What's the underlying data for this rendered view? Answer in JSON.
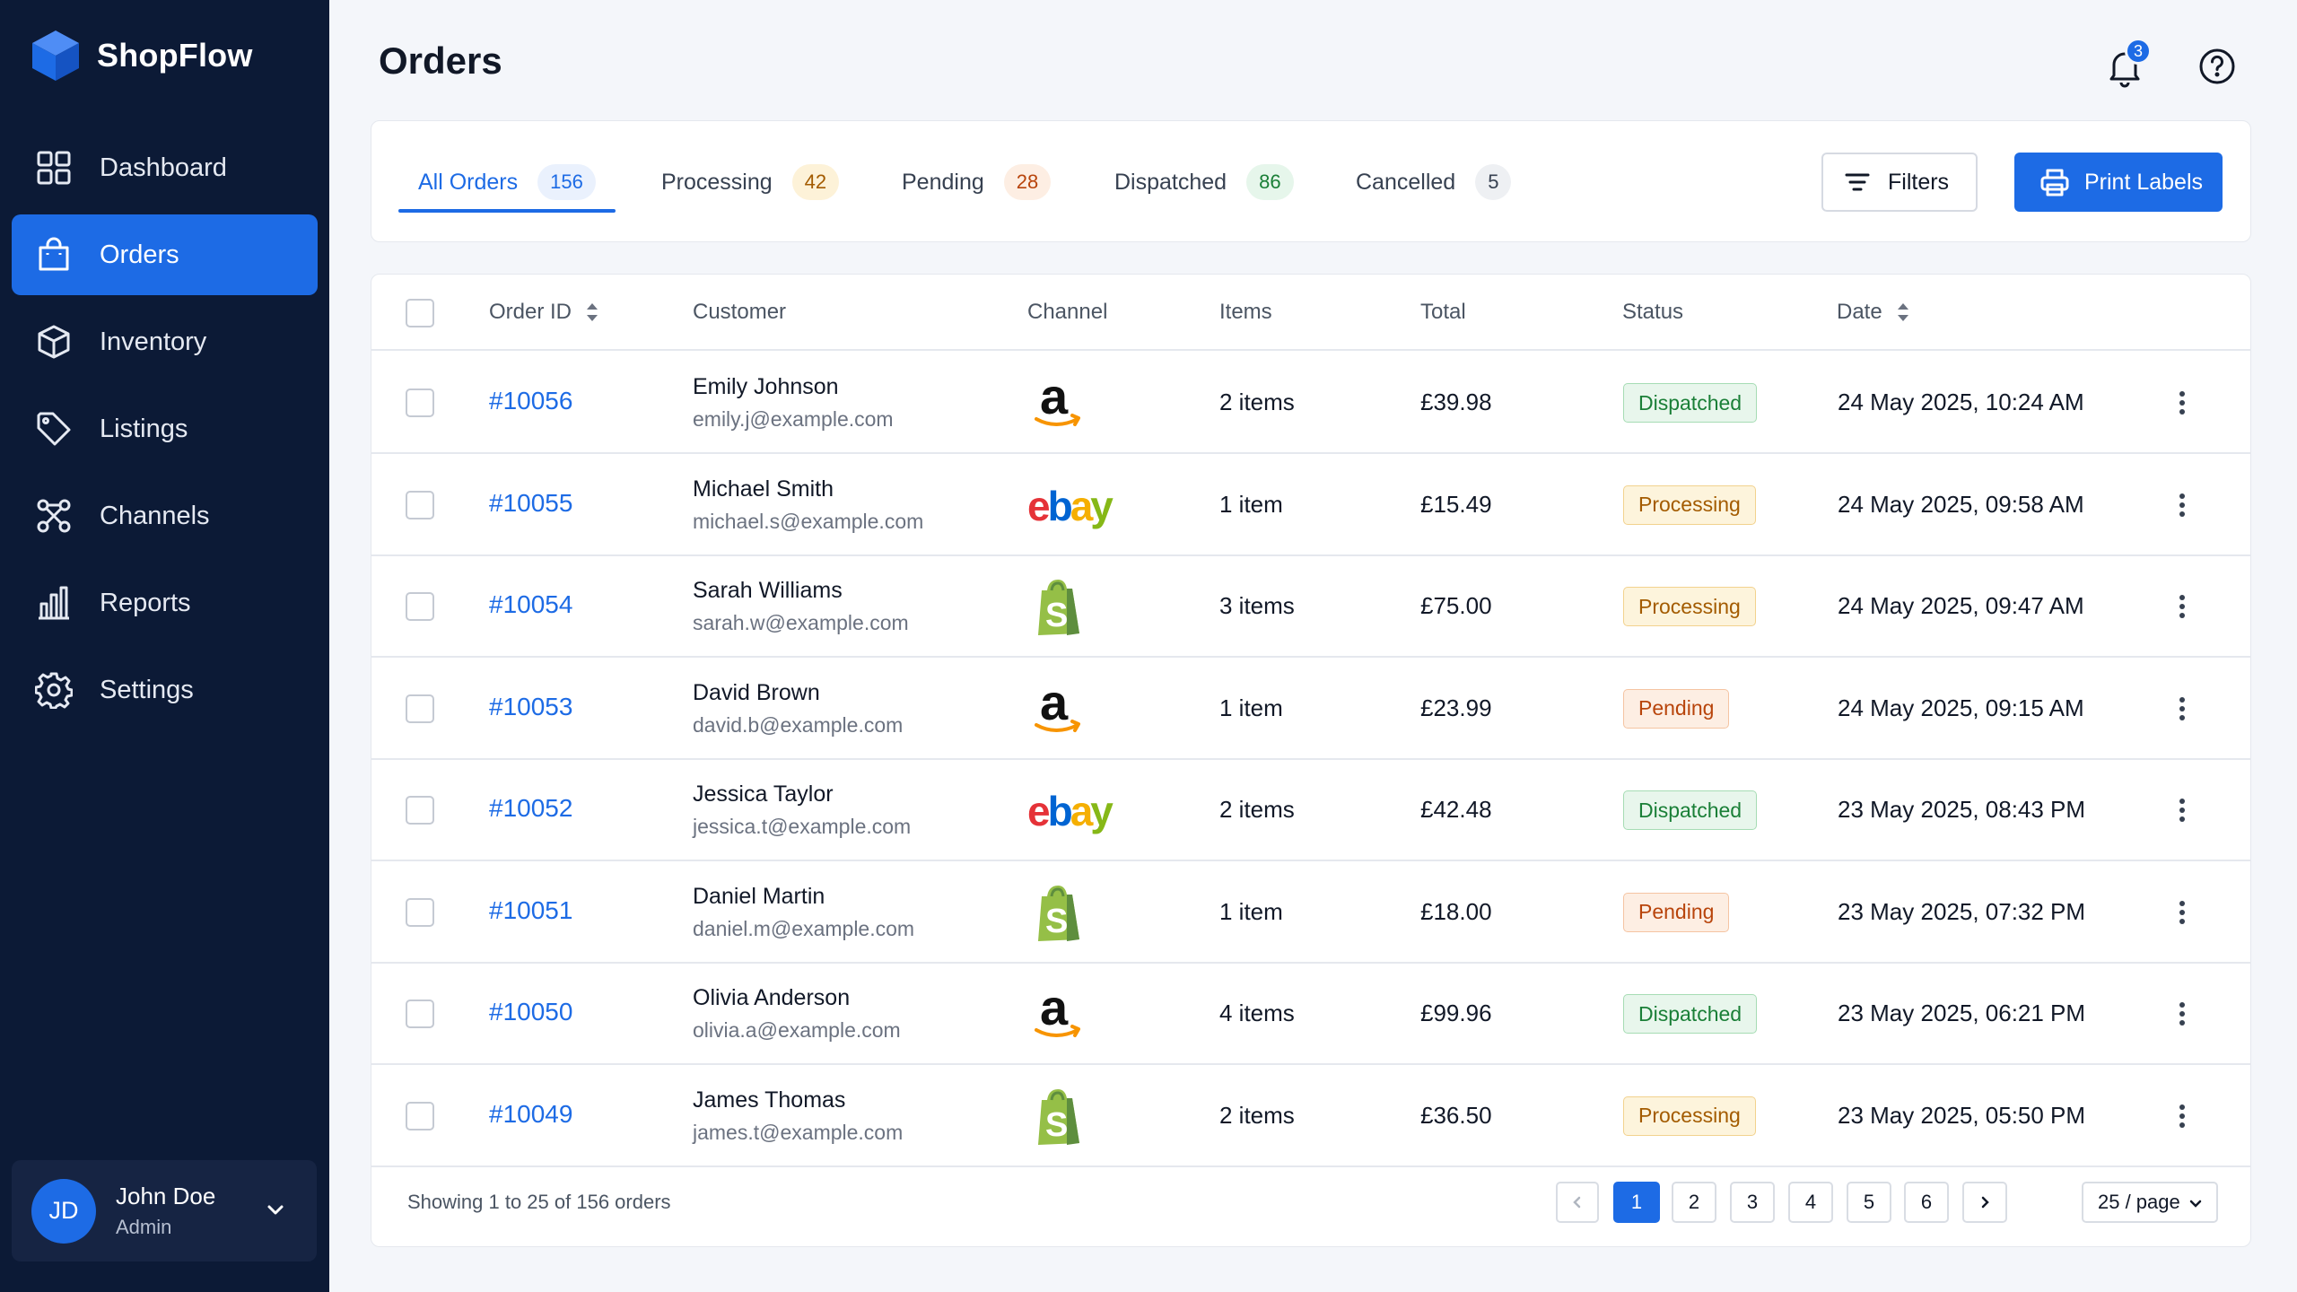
{
  "brand": {
    "name": "ShopFlow"
  },
  "sidebar": {
    "items": [
      {
        "label": "Dashboard",
        "icon": "dashboard-grid-icon"
      },
      {
        "label": "Orders",
        "icon": "shopping-bag-icon",
        "active": true
      },
      {
        "label": "Inventory",
        "icon": "box-icon"
      },
      {
        "label": "Listings",
        "icon": "tag-icon"
      },
      {
        "label": "Channels",
        "icon": "network-icon"
      },
      {
        "label": "Reports",
        "icon": "bar-chart-icon"
      },
      {
        "label": "Settings",
        "icon": "gear-icon"
      }
    ]
  },
  "user": {
    "initials": "JD",
    "name": "John Doe",
    "role": "Admin"
  },
  "header": {
    "title": "Orders",
    "notification_count": "3"
  },
  "tabs": [
    {
      "label": "All Orders",
      "count": "156",
      "active": true
    },
    {
      "label": "Processing",
      "count": "42"
    },
    {
      "label": "Pending",
      "count": "28"
    },
    {
      "label": "Dispatched",
      "count": "86"
    },
    {
      "label": "Cancelled",
      "count": "5"
    }
  ],
  "actions": {
    "filters_label": "Filters",
    "print_label": "Print Labels"
  },
  "table": {
    "columns": {
      "order_id": "Order ID",
      "customer": "Customer",
      "channel": "Channel",
      "items": "Items",
      "total": "Total",
      "status": "Status",
      "date": "Date"
    },
    "rows": [
      {
        "id": "#10056",
        "name": "Emily Johnson",
        "email": "emily.j@example.com",
        "channel": "amazon",
        "items": "2 items",
        "total": "£39.98",
        "status": "Dispatched",
        "date": "24 May 2025, 10:24 AM"
      },
      {
        "id": "#10055",
        "name": "Michael Smith",
        "email": "michael.s@example.com",
        "channel": "ebay",
        "items": "1 item",
        "total": "£15.49",
        "status": "Processing",
        "date": "24 May 2025, 09:58 AM"
      },
      {
        "id": "#10054",
        "name": "Sarah Williams",
        "email": "sarah.w@example.com",
        "channel": "shopify",
        "items": "3 items",
        "total": "£75.00",
        "status": "Processing",
        "date": "24 May 2025, 09:47 AM"
      },
      {
        "id": "#10053",
        "name": "David Brown",
        "email": "david.b@example.com",
        "channel": "amazon",
        "items": "1 item",
        "total": "£23.99",
        "status": "Pending",
        "date": "24 May 2025, 09:15 AM"
      },
      {
        "id": "#10052",
        "name": "Jessica Taylor",
        "email": "jessica.t@example.com",
        "channel": "ebay",
        "items": "2 items",
        "total": "£42.48",
        "status": "Dispatched",
        "date": "23 May 2025, 08:43 PM"
      },
      {
        "id": "#10051",
        "name": "Daniel Martin",
        "email": "daniel.m@example.com",
        "channel": "shopify",
        "items": "1 item",
        "total": "£18.00",
        "status": "Pending",
        "date": "23 May 2025, 07:32 PM"
      },
      {
        "id": "#10050",
        "name": "Olivia Anderson",
        "email": "olivia.a@example.com",
        "channel": "amazon",
        "items": "4 items",
        "total": "£99.96",
        "status": "Dispatched",
        "date": "23 May 2025, 06:21 PM"
      },
      {
        "id": "#10049",
        "name": "James Thomas",
        "email": "james.t@example.com",
        "channel": "shopify",
        "items": "2 items",
        "total": "£36.50",
        "status": "Processing",
        "date": "23 May 2025, 05:50 PM"
      }
    ]
  },
  "footer": {
    "summary": "Showing 1 to 25 of 156 orders",
    "pages": [
      "1",
      "2",
      "3",
      "4",
      "5",
      "6"
    ],
    "current_page": "1",
    "page_size": "25 / page"
  },
  "colors": {
    "accent": "#1d6be5",
    "sidebar_bg": "#0c1a36"
  }
}
